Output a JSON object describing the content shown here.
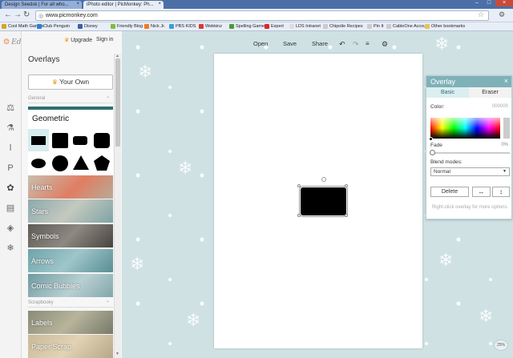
{
  "browser": {
    "tabs": [
      {
        "label": "Design Seedsk | For all who..."
      },
      {
        "label": "iPhoto editor | PicMonkey: Ph..."
      }
    ],
    "url": "www.picmonkey.com",
    "bookmarks": [
      {
        "label": "Cool Math Games",
        "color": "#d9a32a"
      },
      {
        "label": "Club Penguin",
        "color": "#2a7fd9"
      },
      {
        "label": "Disney",
        "color": "#3c5fa8"
      },
      {
        "label": "Friendly Blog",
        "color": "#7cbf3a"
      },
      {
        "label": "Nick Jr.",
        "color": "#f07a2a"
      },
      {
        "label": "PBS KIDS",
        "color": "#3aa0d9"
      },
      {
        "label": "Webkinz",
        "color": "#d93a3a"
      },
      {
        "label": "Spelling Game",
        "color": "#4a9a3a"
      },
      {
        "label": "Expert",
        "color": "#d92a2a"
      },
      {
        "label": "LDS Intranet",
        "color": "#dddddd"
      },
      {
        "label": "Chipotle Recipes",
        "color": "#cccccc"
      },
      {
        "label": "Pin It",
        "color": "#cccccc"
      },
      {
        "label": "CableOne Account",
        "color": "#cccccc"
      },
      {
        "label": "Other bookmarks",
        "color": "#e8c45a"
      }
    ]
  },
  "app": {
    "logo": "Editor",
    "upgrade": "Upgrade",
    "signin": "Sign in",
    "panel_title": "Overlays",
    "your_own": "Your Own",
    "section_general": "General",
    "section_scrapbooky": "Scrapbooky",
    "geometric_title": "Geometric",
    "categories": [
      {
        "label": "Hearts"
      },
      {
        "label": "Stars"
      },
      {
        "label": "Symbols"
      },
      {
        "label": "Arrows"
      },
      {
        "label": "Comic Bubbles"
      }
    ],
    "scrap_categories": [
      {
        "label": "Labels"
      },
      {
        "label": "Paper Scrap"
      }
    ]
  },
  "toolbar": {
    "open": "Open",
    "save": "Save",
    "share": "Share"
  },
  "palette": {
    "title": "Overlay",
    "tab_basic": "Basic",
    "tab_eraser": "Eraser",
    "color_label": "Color:",
    "color_value": "000000",
    "fade_label": "Fade",
    "fade_value": "0%",
    "fade_level": 0,
    "blend_label": "Blend modes:",
    "blend_value": "Normal",
    "delete": "Delete",
    "hint": "Right-click overlay for more options."
  },
  "zoom": "25%"
}
